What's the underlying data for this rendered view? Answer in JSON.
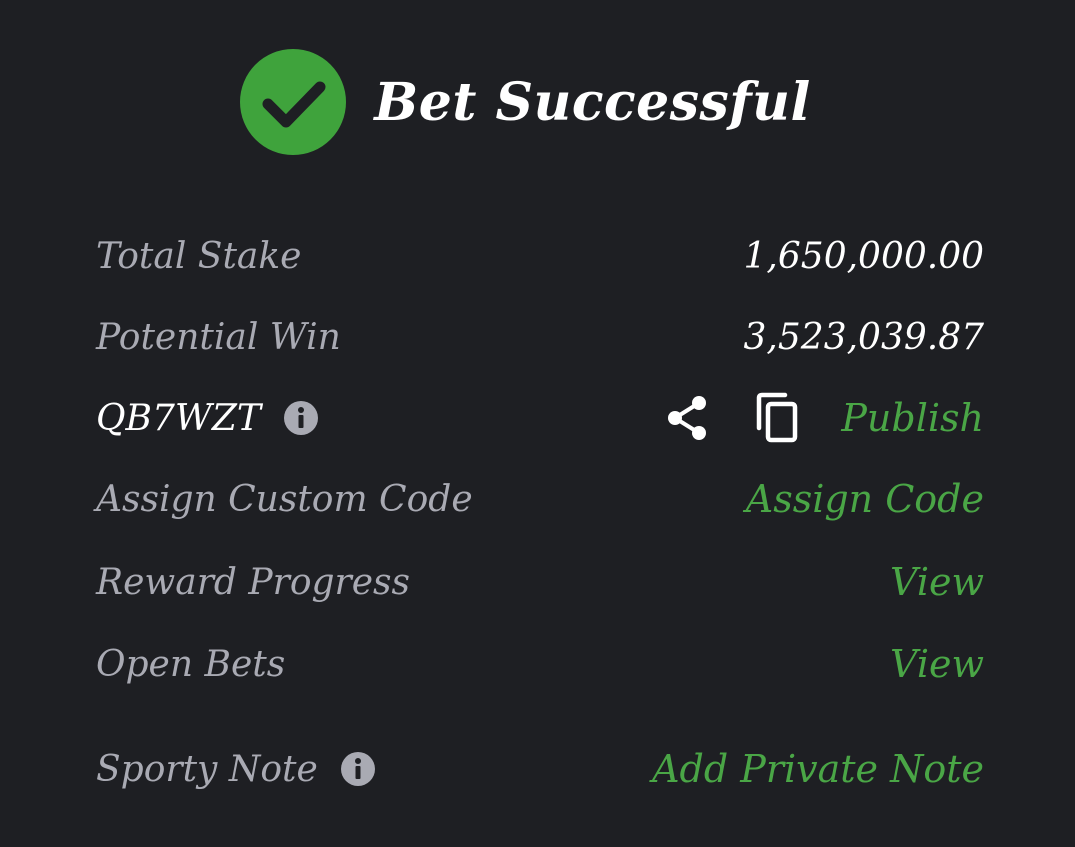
{
  "header": {
    "title": "Bet Successful",
    "icon": "check-circle-icon",
    "icon_color": "#3fa33c"
  },
  "rows": {
    "total_stake": {
      "label": "Total Stake",
      "value": "1,650,000.00"
    },
    "potential_win": {
      "label": "Potential Win",
      "value": "3,523,039.87"
    },
    "booking_code": {
      "code": "QB7WZT",
      "info_icon": "info-icon",
      "share_icon": "share-icon",
      "copy_icon": "copy-icon",
      "publish_label": "Publish"
    },
    "custom_code": {
      "label": "Assign Custom Code",
      "action": "Assign Code"
    },
    "reward_progress": {
      "label": "Reward Progress",
      "action": "View"
    },
    "open_bets": {
      "label": "Open Bets",
      "action": "View"
    },
    "sporty_note": {
      "label": "Sporty Note",
      "info_icon": "info-icon",
      "action": "Add Private Note"
    }
  },
  "colors": {
    "background": "#1e1f23",
    "label": "#a9aab3",
    "value": "#ffffff",
    "accent_green": "#4aa646"
  }
}
